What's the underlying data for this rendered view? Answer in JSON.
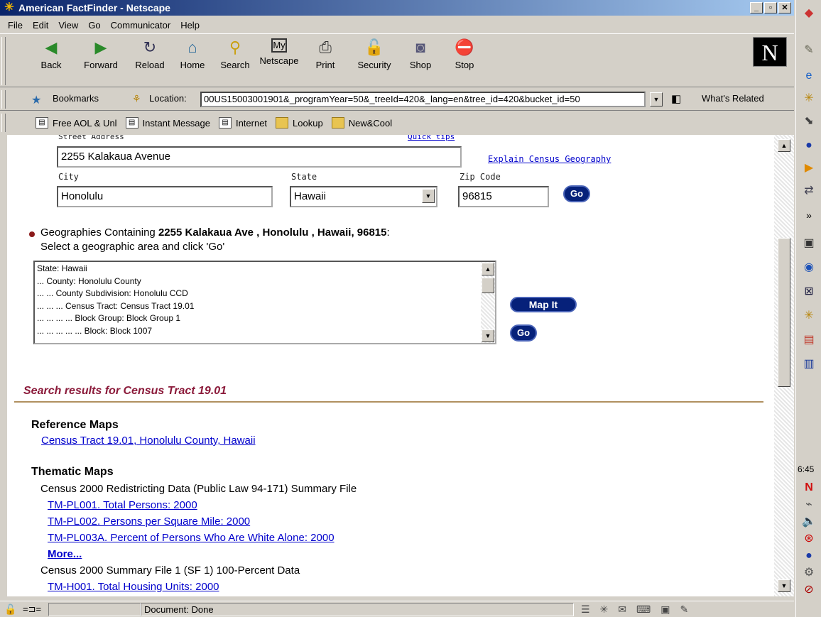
{
  "window": {
    "title": "American FactFinder - Netscape"
  },
  "menu": [
    "File",
    "Edit",
    "View",
    "Go",
    "Communicator",
    "Help"
  ],
  "toolbar": [
    {
      "label": "Back",
      "icon": "back-arrow-icon"
    },
    {
      "label": "Forward",
      "icon": "forward-arrow-icon"
    },
    {
      "label": "Reload",
      "icon": "reload-icon"
    },
    {
      "label": "Home",
      "icon": "home-icon"
    },
    {
      "label": "Search",
      "icon": "search-icon"
    },
    {
      "label": "Netscape",
      "icon": "my-netscape-icon"
    },
    {
      "label": "Print",
      "icon": "print-icon"
    },
    {
      "label": "Security",
      "icon": "security-lock-icon"
    },
    {
      "label": "Shop",
      "icon": "shop-icon"
    },
    {
      "label": "Stop",
      "icon": "stop-icon"
    }
  ],
  "location": {
    "bookmarks_label": "Bookmarks",
    "label": "Location:",
    "url": "00US15003001901&_programYear=50&_treeId=420&_lang=en&tree_id=420&bucket_id=50",
    "whats_related": "What's Related"
  },
  "personal_toolbar": [
    "Free AOL & Unl",
    "Instant Message",
    "Internet",
    "Lookup",
    "New&Cool"
  ],
  "form": {
    "street_label": "Street Address",
    "quick_tips": "Quick tips",
    "street_value": "2255 Kalakaua Avenue",
    "explain_link": "Explain Census Geography",
    "city_label": "City",
    "city_value": "Honolulu",
    "state_label": "State",
    "state_value": "Hawaii",
    "zip_label": "Zip Code",
    "zip_value": "96815",
    "go_label": "Go"
  },
  "geographies": {
    "prefix": "Geographies Containing ",
    "address": "2255 Kalakaua Ave , Honolulu , Hawaii, 96815",
    "suffix": ":",
    "instruction": "Select a geographic area and click 'Go'",
    "items": [
      "State: Hawaii",
      "... County: Honolulu County",
      "... ... County Subdivision: Honolulu CCD",
      "... ... ... Census Tract: Census Tract 19.01",
      "... ... ... ... Block Group: Block Group 1",
      "... ... ... ... ... Block: Block 1007"
    ],
    "map_it_label": "Map It",
    "go_label": "Go"
  },
  "results": {
    "title": "Search results for Census Tract 19.01",
    "reference_heading": "Reference Maps",
    "reference_link": "Census Tract 19.01, Honolulu County, Hawaii",
    "thematic_heading": "Thematic Maps",
    "pl_dataset": "Census 2000 Redistricting Data (Public Law 94-171) Summary File",
    "pl_links": [
      "TM-PL001. Total Persons: 2000",
      "TM-PL002. Persons per Square Mile: 2000",
      "TM-PL003A. Percent of Persons Who Are White Alone: 2000"
    ],
    "more_label": "More...",
    "sf1_dataset": "Census 2000 Summary File 1 (SF 1) 100-Percent Data",
    "sf1_links": [
      "TM-H001. Total Housing Units: 2000"
    ]
  },
  "status": {
    "text": "Document: Done"
  },
  "taskbar": {
    "clock": "6:45"
  }
}
